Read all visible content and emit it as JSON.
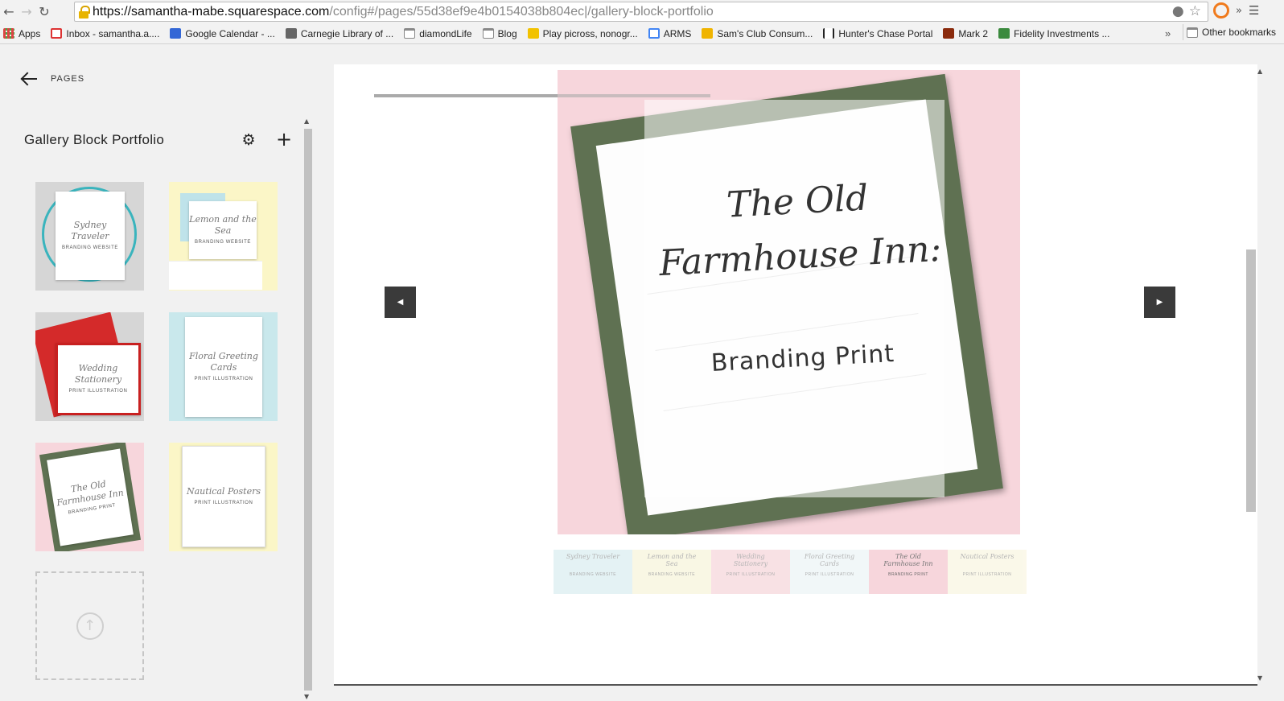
{
  "browser": {
    "url_host": "https://samantha-mabe.squarespace.com",
    "url_path": "/config#/pages/55d38ef9e4b0154038b804ec|/gallery-block-portfolio",
    "more_label": "»",
    "bookmarks": [
      {
        "label": "Apps",
        "icon": "apps-icon"
      },
      {
        "label": "Inbox - samantha.a....",
        "icon": "gmail-icon"
      },
      {
        "label": "Google Calendar - ...",
        "icon": "calendar-icon"
      },
      {
        "label": "Carnegie Library of ...",
        "icon": "library-icon"
      },
      {
        "label": "diamondLife",
        "icon": "folder-icon"
      },
      {
        "label": "Blog",
        "icon": "folder-icon"
      },
      {
        "label": "Play picross, nonogr...",
        "icon": "picross-icon"
      },
      {
        "label": "ARMS",
        "icon": "google-icon"
      },
      {
        "label": "Sam's Club Consum...",
        "icon": "sams-icon"
      },
      {
        "label": "Hunter's Chase Portal",
        "icon": "hunters-icon"
      },
      {
        "label": "Mark 2",
        "icon": "mark-icon"
      },
      {
        "label": "Fidelity Investments ...",
        "icon": "fidelity-icon"
      }
    ],
    "other_bookmarks": "Other bookmarks"
  },
  "panel": {
    "back_label": "PAGES",
    "title": "Gallery Block Portfolio",
    "tiles": [
      {
        "script": "Sydney Traveler",
        "caps": "BRANDING WEBSITE",
        "bg": "#d6d6d6"
      },
      {
        "script": "Lemon and the Sea",
        "caps": "BRANDING WEBSITE",
        "bg": "#fbf6c7"
      },
      {
        "script": "Wedding Stationery",
        "caps": "PRINT ILLUSTRATION",
        "bg": "#d6d6d6"
      },
      {
        "script": "Floral Greeting Cards",
        "caps": "PRINT ILLUSTRATION",
        "bg": "#c9e8ec"
      },
      {
        "script": "The Old Farmhouse Inn",
        "caps": "BRANDING PRINT",
        "bg": "#f7d6dc"
      },
      {
        "script": "Nautical Posters",
        "caps": "PRINT ILLUSTRATION",
        "bg": "#fbf6c7"
      }
    ]
  },
  "preview": {
    "hero_title": "The Old Farmhouse Inn:",
    "hero_sub": "Branding Print",
    "thumbs": [
      {
        "script": "Sydney Traveler",
        "caps": "BRANDING WEBSITE",
        "bg": "#cfe9ec"
      },
      {
        "script": "Lemon and the Sea",
        "caps": "BRANDING WEBSITE",
        "bg": "#f5f1cf"
      },
      {
        "script": "Wedding Stationery",
        "caps": "PRINT ILLUSTRATION",
        "bg": "#f4c9cf"
      },
      {
        "script": "Floral Greeting Cards",
        "caps": "PRINT ILLUSTRATION",
        "bg": "#e6f2f4"
      },
      {
        "script": "The Old Farmhouse Inn",
        "caps": "BRANDING PRINT",
        "bg": "#f7d6dc"
      },
      {
        "script": "Nautical Posters",
        "caps": "PRINT ILLUSTRATION",
        "bg": "#f7f3d8"
      }
    ]
  },
  "colors": {
    "hero_bg": "#f7d6dc",
    "frame_green": "#5f7152",
    "arrow_bg": "#3a3a3a"
  }
}
